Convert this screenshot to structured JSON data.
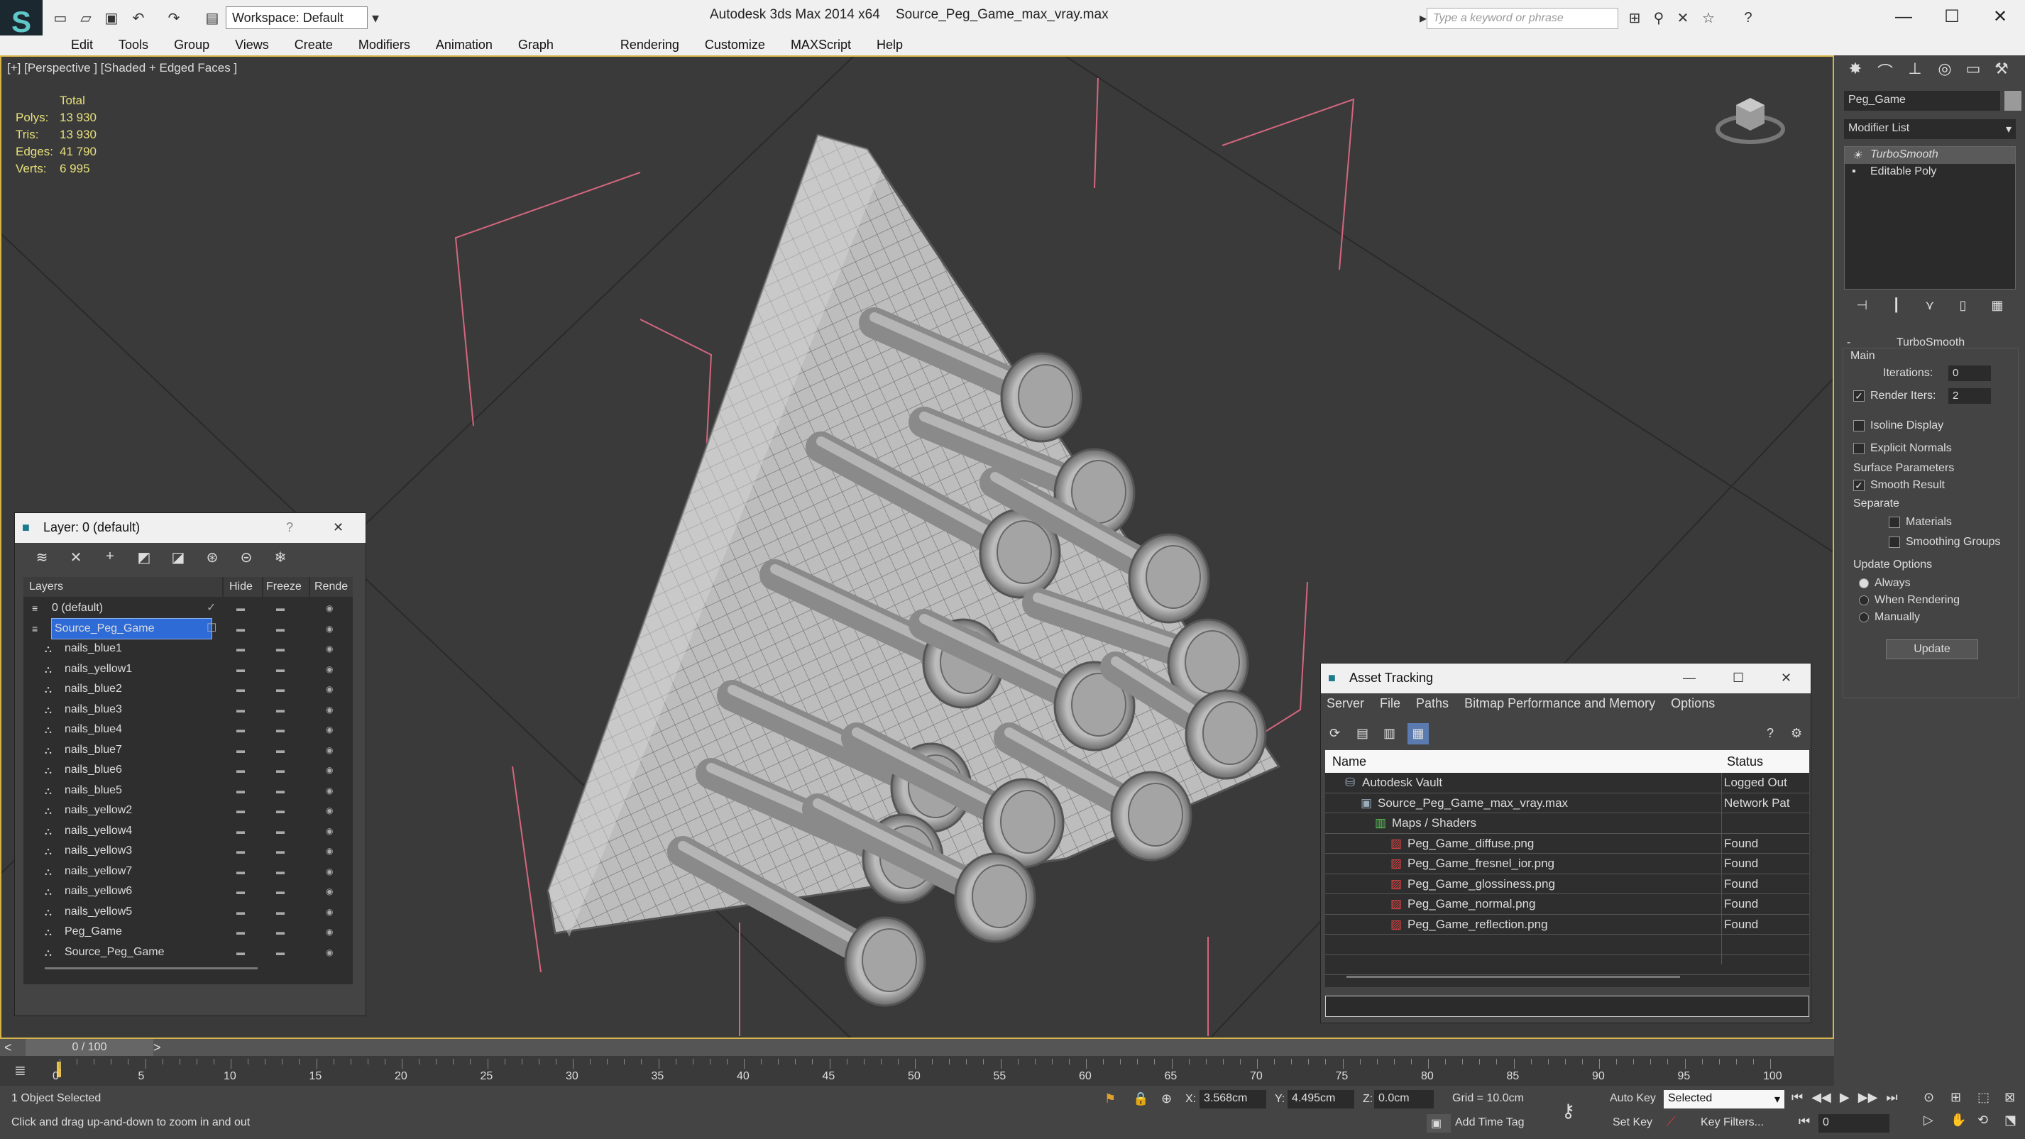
{
  "titlebar": {
    "workspace": "Workspace: Default",
    "app_title": "Autodesk 3ds Max  2014 x64",
    "file_title": "Source_Peg_Game_max_vray.max",
    "search_placeholder": "Type a keyword or phrase"
  },
  "menu": [
    "Edit",
    "Tools",
    "Group",
    "Views",
    "Create",
    "Modifiers",
    "Animation",
    "Graph Editors",
    "Rendering",
    "Customize",
    "MAXScript",
    "Help"
  ],
  "viewport": {
    "label": "[+] [Perspective ] [Shaded + Edged Faces ]",
    "stats": {
      "header": "Total",
      "rows": [
        {
          "k": "Polys:",
          "v": "13 930"
        },
        {
          "k": "Tris:",
          "v": "13 930"
        },
        {
          "k": "Edges:",
          "v": "41 790"
        },
        {
          "k": "Verts:",
          "v": "6 995"
        }
      ]
    }
  },
  "command_panel": {
    "object_name": "Peg_Game",
    "modifier_list": "Modifier List",
    "stack": [
      "TurboSmooth",
      "Editable Poly"
    ],
    "rollout_title": "TurboSmooth",
    "main_label": "Main",
    "iterations_label": "Iterations:",
    "iterations_value": "0",
    "render_iters_label": "Render Iters:",
    "render_iters_value": "2",
    "isoline": "Isoline Display",
    "explicit": "Explicit Normals",
    "surface_label": "Surface Parameters",
    "smooth_result": "Smooth Result",
    "separate_label": "Separate",
    "materials": "Materials",
    "smoothing_groups": "Smoothing Groups",
    "update_label": "Update Options",
    "always": "Always",
    "when_rendering": "When Rendering",
    "manually": "Manually",
    "update_button": "Update"
  },
  "layer_window": {
    "title": "Layer: 0 (default)",
    "help": "?",
    "columns": [
      "Layers",
      "Hide",
      "Freeze",
      "Rende"
    ],
    "rows": [
      "0 (default)",
      "Source_Peg_Game",
      "nails_blue1",
      "nails_yellow1",
      "nails_blue2",
      "nails_blue3",
      "nails_blue4",
      "nails_blue7",
      "nails_blue6",
      "nails_blue5",
      "nails_yellow2",
      "nails_yellow4",
      "nails_yellow3",
      "nails_yellow7",
      "nails_yellow6",
      "nails_yellow5",
      "Peg_Game",
      "Source_Peg_Game"
    ]
  },
  "asset_window": {
    "title": "Asset Tracking",
    "menu": [
      "Server",
      "File",
      "Paths",
      "Bitmap Performance and Memory",
      "Options"
    ],
    "col_name": "Name",
    "col_status": "Status",
    "rows": [
      {
        "name": "Autodesk Vault",
        "status": "Logged Out"
      },
      {
        "name": "Source_Peg_Game_max_vray.max",
        "status": "Network Pat"
      },
      {
        "name": "Maps / Shaders",
        "status": ""
      },
      {
        "name": "Peg_Game_diffuse.png",
        "status": "Found"
      },
      {
        "name": "Peg_Game_fresnel_ior.png",
        "status": "Found"
      },
      {
        "name": "Peg_Game_glossiness.png",
        "status": "Found"
      },
      {
        "name": "Peg_Game_normal.png",
        "status": "Found"
      },
      {
        "name": "Peg_Game_reflection.png",
        "status": "Found"
      }
    ]
  },
  "timeline": {
    "frame": "0 / 100",
    "ticks": [
      "0",
      "5",
      "10",
      "15",
      "20",
      "25",
      "30",
      "35",
      "40",
      "45",
      "50",
      "55",
      "60",
      "65",
      "70",
      "75",
      "80",
      "85",
      "90",
      "95",
      "100"
    ]
  },
  "status": {
    "selected": "1 Object Selected",
    "prompt": "Click and drag up-and-down to zoom in and out",
    "x_label": "X:",
    "x": "3.568cm",
    "y_label": "Y:",
    "y": "4.495cm",
    "z_label": "Z:",
    "z": "0.0cm",
    "grid": "Grid = 10.0cm",
    "auto_key": "Auto Key",
    "selected_mode": "Selected",
    "set_key": "Set Key",
    "key_filters": "Key Filters...",
    "add_time_tag": "Add Time Tag",
    "frame_value": "0"
  }
}
